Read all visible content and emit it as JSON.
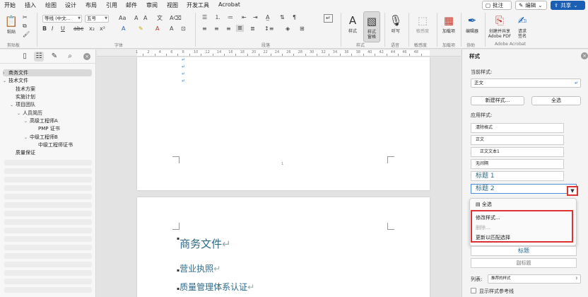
{
  "menu": {
    "tabs": [
      "开始",
      "插入",
      "绘图",
      "设计",
      "布局",
      "引用",
      "邮件",
      "审阅",
      "视图",
      "开发工具",
      "Acrobat"
    ],
    "comments_label": "批注",
    "editing_label": "编辑",
    "share_label": "共享"
  },
  "ribbon": {
    "paste_label": "粘贴",
    "font_name": "等线 (中文...",
    "font_size": "五号",
    "styles_label": "样式",
    "styles_pane_label": "样式\n窗格",
    "dictate_label": "听写",
    "sensitivity_label": "敏感度",
    "addins_label": "加载项",
    "editor_label": "编辑器",
    "create_pdf_label": "创建并共享\nAdobe PDF",
    "request_sign_label": "请求\n签名",
    "group_labels": {
      "clipboard": "剪贴板",
      "font": "字体",
      "paragraph": "段落",
      "styles": "样式",
      "voice": "语音",
      "sensitivity": "敏感度",
      "addins": "加载项",
      "collab": "协助",
      "acrobat": "Adobe Acrobat"
    }
  },
  "nav": {
    "items": [
      {
        "label": "商务文件",
        "caret": "›",
        "active": true
      },
      {
        "label": "技术文件",
        "caret": "⌄"
      },
      {
        "label": "技术方案",
        "caret": ""
      },
      {
        "label": "实施计划",
        "caret": ""
      },
      {
        "label": "项目团队",
        "caret": "⌄"
      },
      {
        "label": "人员简历",
        "caret": "⌄"
      },
      {
        "label": "高级工程师A",
        "caret": "⌄"
      },
      {
        "label": "PMP 证书",
        "caret": ""
      },
      {
        "label": "中级工程师B",
        "caret": "⌄"
      },
      {
        "label": "中级工程师证书",
        "caret": ""
      },
      {
        "label": "质量保证",
        "caret": ""
      }
    ]
  },
  "ruler": {
    "numbers": [
      "1",
      "2",
      "4",
      "6",
      "8",
      "10",
      "12",
      "14",
      "16",
      "18",
      "20",
      "22",
      "24",
      "26",
      "28",
      "30",
      "32",
      "34",
      "36",
      "38",
      "40",
      "42",
      "44",
      "46",
      "48"
    ]
  },
  "document": {
    "page_number": "1",
    "heading": "商务文件",
    "items": [
      "营业执照",
      "质量管理体系认证"
    ]
  },
  "styles_pane": {
    "title": "样式",
    "current_style_label": "当前样式:",
    "current_style_value": "正文",
    "new_style_btn": "新建样式...",
    "select_all_btn": "全选",
    "apply_style_label": "应用样式:",
    "style_list": [
      "清除格式",
      "正文",
      "正文文本1",
      "无间隔",
      "标题 1",
      "标题 2"
    ],
    "menu": {
      "select_all": "全选",
      "modify": "修改样式...",
      "delete": "删除...",
      "update": "更新以匹配选择"
    },
    "below_items": [
      "标题",
      "副标题"
    ],
    "list_label": "列表:",
    "list_value": "推荐的样式",
    "show_guide_label": "显示样式参考线"
  }
}
